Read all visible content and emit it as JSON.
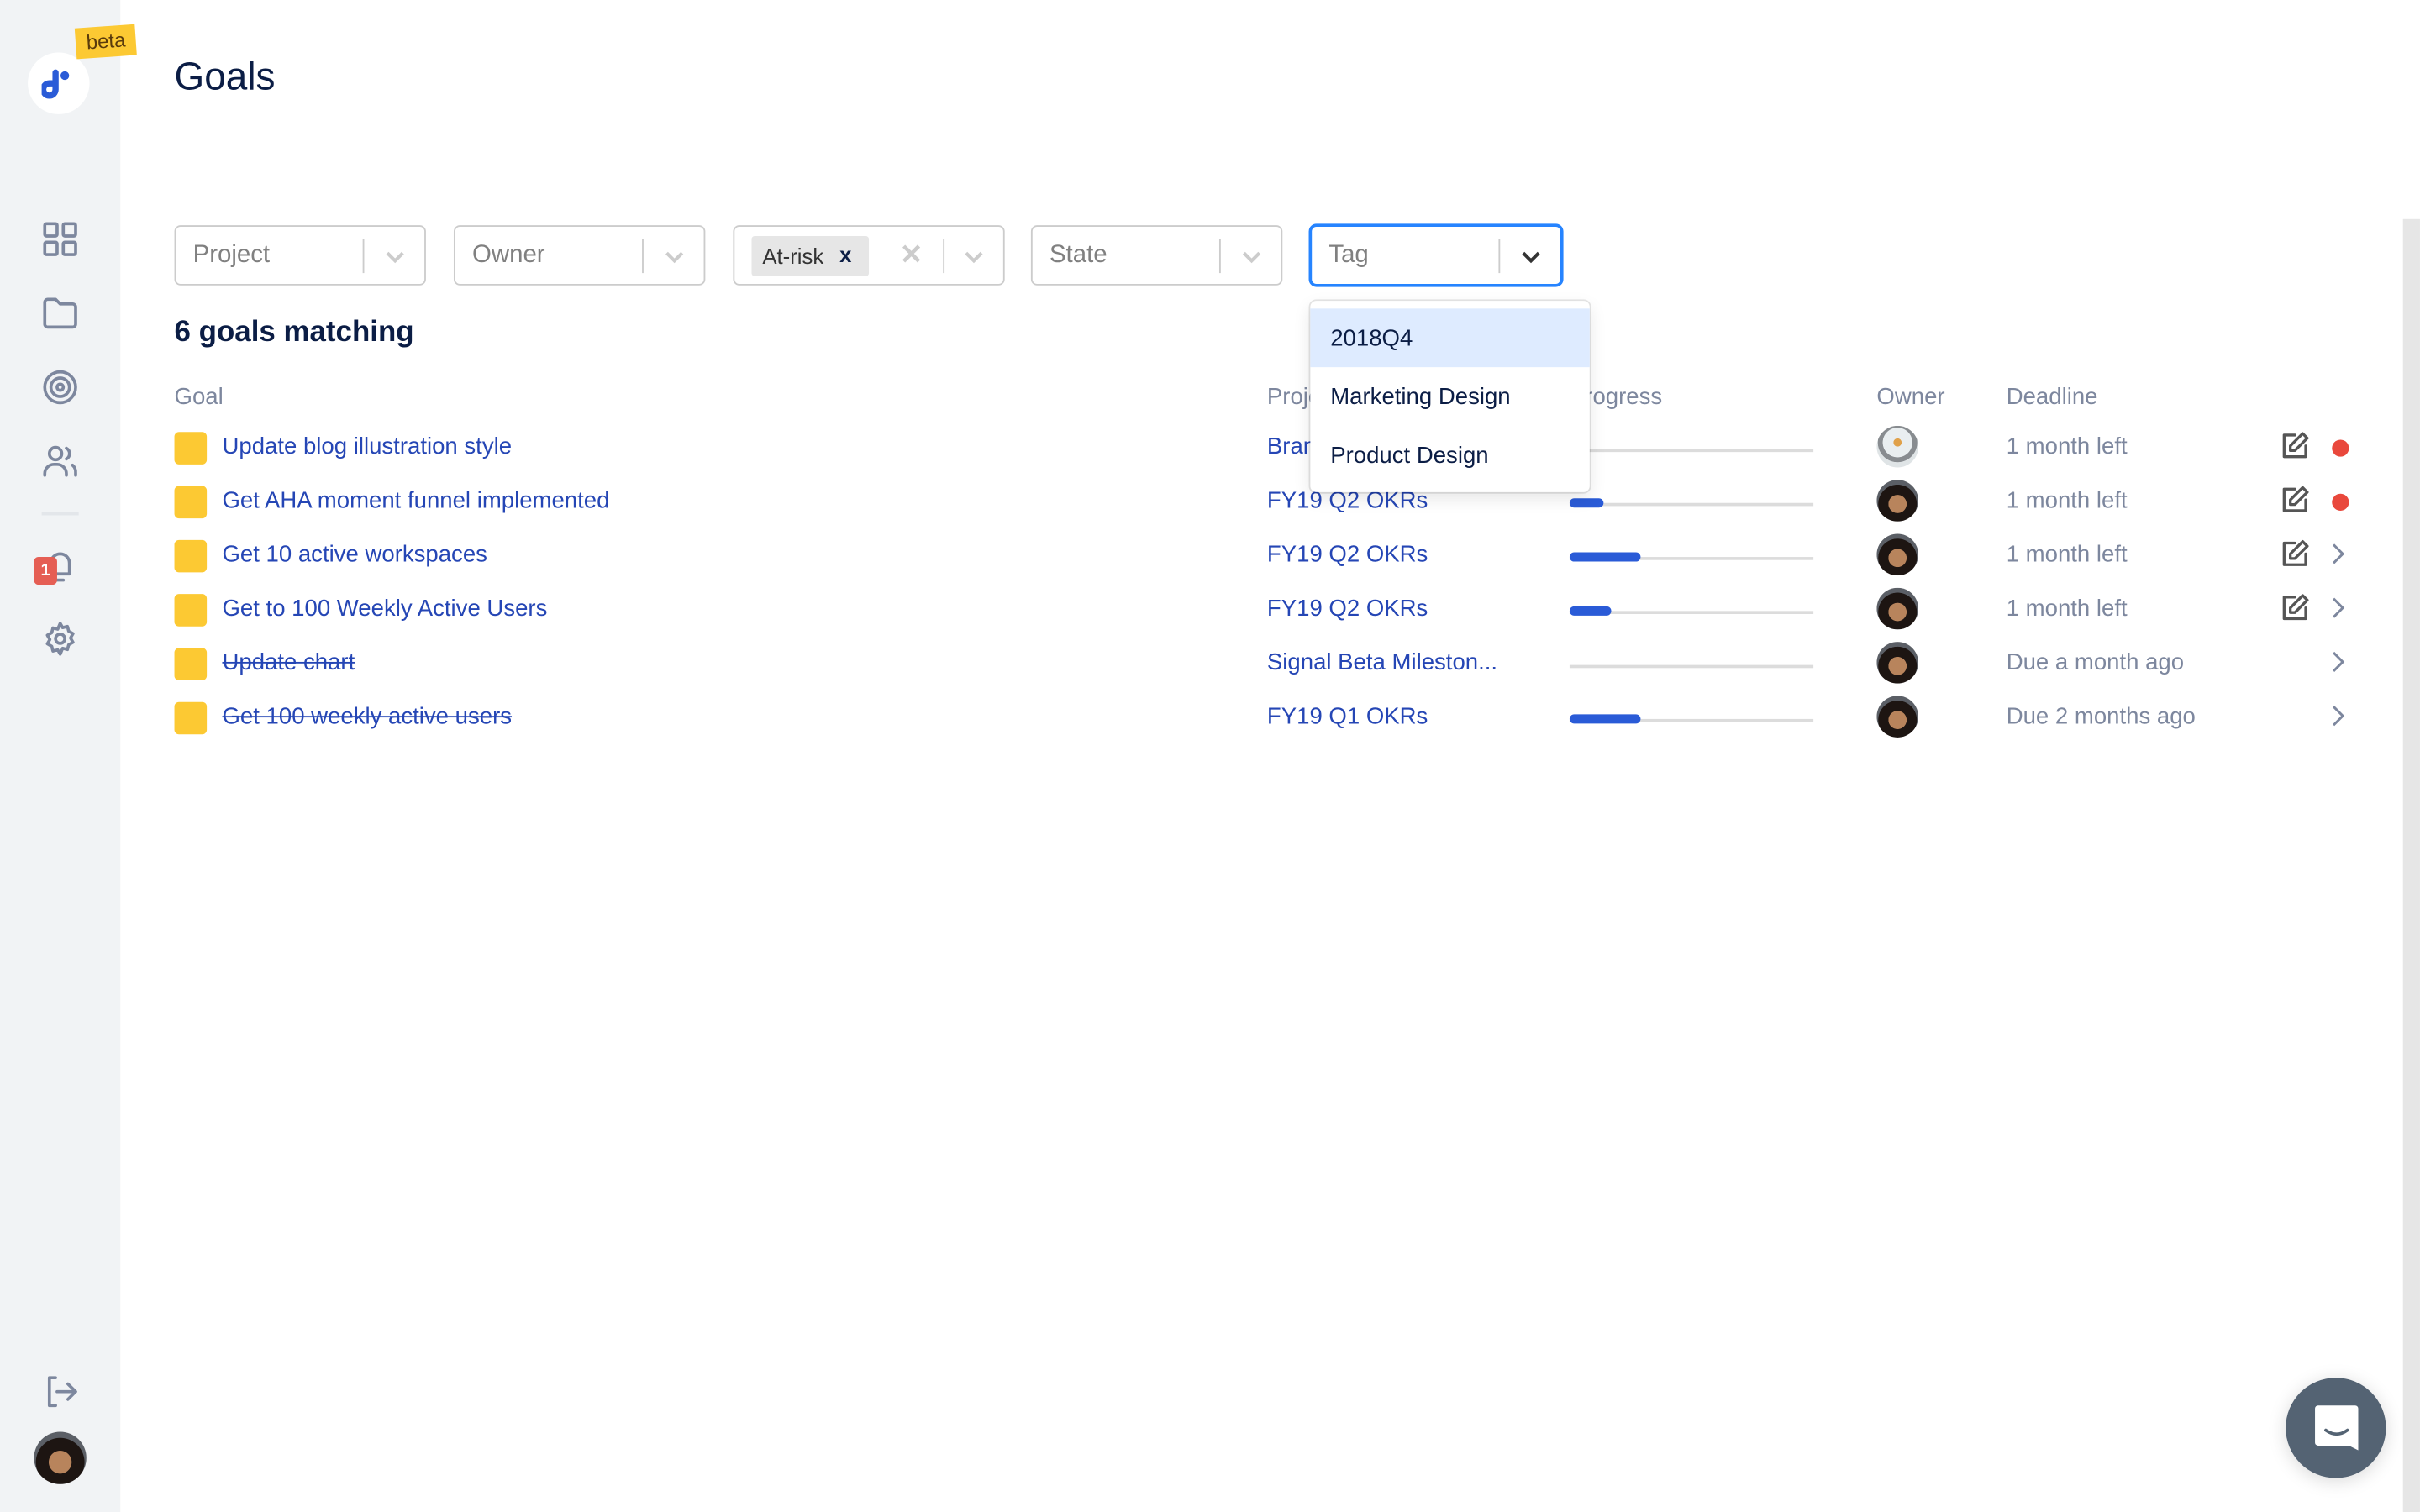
{
  "app": {
    "beta_label": "beta",
    "notification_count": "1"
  },
  "sidebar": {
    "items": [
      {
        "name": "dashboard",
        "icon": "grid-icon"
      },
      {
        "name": "projects",
        "icon": "folder-icon"
      },
      {
        "name": "goals",
        "icon": "target-icon"
      },
      {
        "name": "people",
        "icon": "users-icon"
      },
      {
        "name": "notifications",
        "icon": "bell-icon"
      },
      {
        "name": "settings",
        "icon": "gear-icon"
      }
    ],
    "bottom": [
      {
        "name": "logout",
        "icon": "logout-icon"
      },
      {
        "name": "profile",
        "icon": "avatar"
      }
    ]
  },
  "page": {
    "title": "Goals",
    "count_label": "6 goals matching"
  },
  "filters": {
    "project": {
      "placeholder": "Project"
    },
    "owner": {
      "placeholder": "Owner"
    },
    "status": {
      "chip": "At-risk",
      "chip_remove": "x",
      "clear": "✕"
    },
    "state": {
      "placeholder": "State"
    },
    "tag": {
      "placeholder": "Tag",
      "open": true
    }
  },
  "tag_menu": {
    "options": [
      "2018Q4",
      "Marketing Design",
      "Product Design"
    ],
    "highlighted_index": 0
  },
  "table": {
    "columns": [
      "Goal",
      "Project",
      "Progress",
      "Owner",
      "Deadline"
    ],
    "rows": [
      {
        "goal": "Update blog illustration style",
        "project": "Brand",
        "progress": 0,
        "owner": "avatar-light",
        "deadline": "1 month left",
        "done": false,
        "editable": true,
        "status": "at-risk-dot"
      },
      {
        "goal": "Get AHA moment funnel implemented",
        "project": "FY19 Q2 OKRs",
        "progress": 14,
        "owner": "avatar-dark",
        "deadline": "1 month left",
        "done": false,
        "editable": true,
        "status": "at-risk-dot"
      },
      {
        "goal": "Get 10 active workspaces",
        "project": "FY19 Q2 OKRs",
        "progress": 29,
        "owner": "avatar-dark",
        "deadline": "1 month left",
        "done": false,
        "editable": true,
        "status": "chevron"
      },
      {
        "goal": "Get to 100 Weekly Active Users",
        "project": "FY19 Q2 OKRs",
        "progress": 17,
        "owner": "avatar-dark",
        "deadline": "1 month left",
        "done": false,
        "editable": true,
        "status": "chevron"
      },
      {
        "goal": "Update chart",
        "project": "Signal Beta Mileston...",
        "progress": 0,
        "owner": "avatar-dark",
        "deadline": "Due a month ago",
        "done": true,
        "editable": false,
        "status": "chevron"
      },
      {
        "goal": "Get 100 weekly active users",
        "project": "FY19 Q1 OKRs",
        "progress": 29,
        "owner": "avatar-dark",
        "deadline": "Due 2 months ago",
        "done": true,
        "editable": false,
        "status": "chevron"
      }
    ]
  },
  "colors": {
    "accent": "#2a5bd7",
    "link": "#2546b5",
    "goal_marker": "#fcc933",
    "at_risk": "#e9483c",
    "focus": "#2684ff",
    "chat_button": "#546373"
  }
}
